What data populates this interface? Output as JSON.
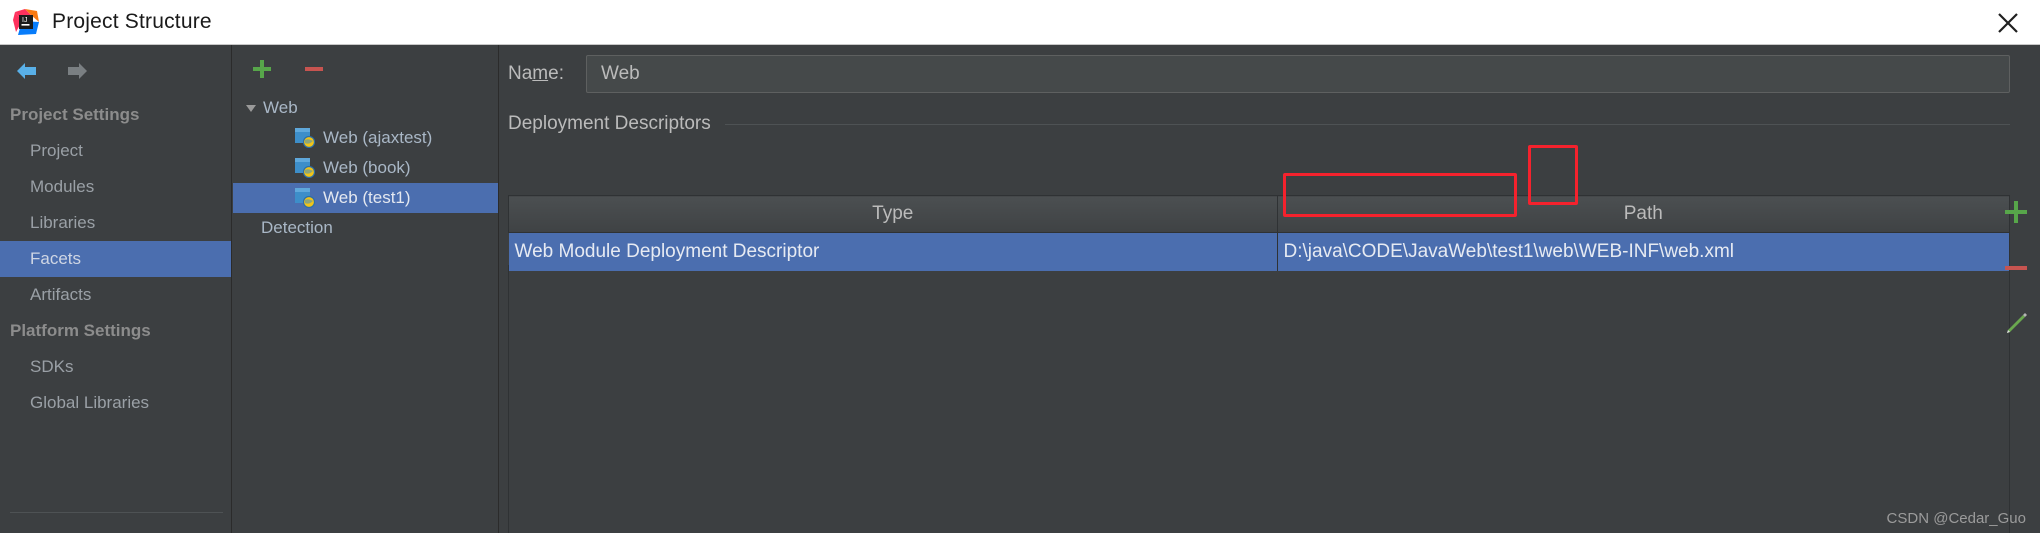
{
  "window": {
    "title": "Project Structure",
    "logo_icon": "intellij-idea-logo",
    "close_icon": "close-icon"
  },
  "sidebar": {
    "nav": {
      "back_icon": "arrow-left-icon",
      "forward_icon": "arrow-right-icon"
    },
    "groups": [
      {
        "label": "Project Settings",
        "items": [
          {
            "label": "Project",
            "selected": false
          },
          {
            "label": "Modules",
            "selected": false
          },
          {
            "label": "Libraries",
            "selected": false
          },
          {
            "label": "Facets",
            "selected": true
          },
          {
            "label": "Artifacts",
            "selected": false
          }
        ]
      },
      {
        "label": "Platform Settings",
        "items": [
          {
            "label": "SDKs",
            "selected": false
          },
          {
            "label": "Global Libraries",
            "selected": false
          }
        ]
      }
    ]
  },
  "tree_panel": {
    "toolbar": {
      "add_label": "+",
      "add_icon": "plus-icon",
      "remove_label": "–",
      "remove_icon": "minus-icon"
    },
    "rows": [
      {
        "label": "Web",
        "level": "root",
        "icon": "",
        "selected": false,
        "expanded": true
      },
      {
        "label": "Web (ajaxtest)",
        "level": "child",
        "icon": "web-facet-icon",
        "selected": false
      },
      {
        "label": "Web (book)",
        "level": "child",
        "icon": "web-facet-icon",
        "selected": false
      },
      {
        "label": "Web (test1)",
        "level": "child",
        "icon": "web-facet-icon",
        "selected": true
      },
      {
        "label": "Detection",
        "level": "flat",
        "icon": "",
        "selected": false
      }
    ]
  },
  "main": {
    "name_label_pre": "Na",
    "name_label_mnemonic": "m",
    "name_label_post": "e:",
    "name_value": "Web",
    "section_title": "Deployment Descriptors",
    "table": {
      "columns": [
        "Type",
        "Path"
      ],
      "rows": [
        {
          "type": "Web Module Deployment Descriptor",
          "path_prefix": "D:\\java\\CODE\\JavaWeb\\test1\\",
          "path_highlight": "web\\WEB-INF\\web.xml",
          "selected": true
        }
      ]
    }
  },
  "right_toolbar": {
    "buttons": [
      {
        "name": "add-descriptor-button",
        "icon": "plus-icon",
        "label": "+"
      },
      {
        "name": "remove-descriptor-button",
        "icon": "minus-icon",
        "label": "–"
      },
      {
        "name": "edit-descriptor-button",
        "icon": "pencil-icon",
        "label": ""
      }
    ]
  },
  "annotations": {
    "path_box_color": "#f5222d",
    "add_box_color": "#f5222d"
  },
  "watermark": "CSDN @Cedar_Guo"
}
